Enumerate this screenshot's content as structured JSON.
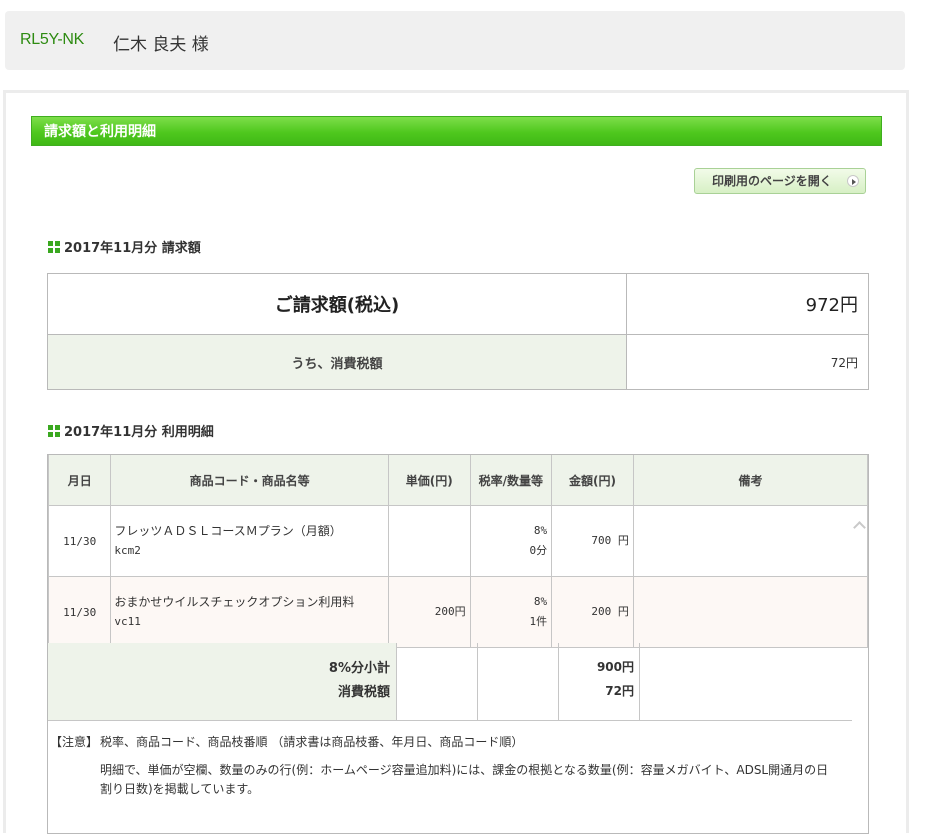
{
  "topbar": {
    "account_code": "RL5Y-NK",
    "user_name": "仁木 良夫 様"
  },
  "header": {
    "title": "請求額と利用明細"
  },
  "print_button": {
    "label": "印刷用のページを開く"
  },
  "billing_section": {
    "title": "2017年11月分 請求額",
    "total_label": "ご請求額(税込)",
    "total_value": "972円",
    "tax_label": "うち、消費税額",
    "tax_value": "72円"
  },
  "detail_section": {
    "title": "2017年11月分 利用明細",
    "columns": [
      "月日",
      "商品コード・商品名等",
      "単価(円)",
      "税率/数量等",
      "金額(円)",
      "備考"
    ],
    "rows": [
      {
        "date": "11/30",
        "name": "フレッツＡＤＳＬコースＭプラン（月額）",
        "code": "kcm2",
        "unit_price": "",
        "tax_rate": "8%",
        "quantity": "0分",
        "amount": "700 円",
        "remarks": ""
      },
      {
        "date": "11/30",
        "name": "おまかせウイルスチェックオプション利用料",
        "code": "vc11",
        "unit_price": "200円",
        "tax_rate": "8%",
        "quantity": "1件",
        "amount": "200 円",
        "remarks": ""
      }
    ],
    "subtotal_label": "8%分小計",
    "subtotal_value": "900円",
    "subtotal_tax_label": "消費税額",
    "subtotal_tax_value": "72円"
  },
  "note": {
    "tag": "【注意】",
    "line1": "税率、商品コード、商品枝番順 （請求書は商品枝番、年月日、商品コード順）",
    "line2": "明細で、単価が空欄、数量のみの行(例：ホームページ容量追加料)には、課金の根拠となる数量(例：容量メガバイト、ADSL開通月の日割り日数)を掲載しています。"
  },
  "colors": {
    "accent_green": "#4fc81e",
    "link_green": "#2e8b12",
    "header_bg": "#eef3ea"
  }
}
